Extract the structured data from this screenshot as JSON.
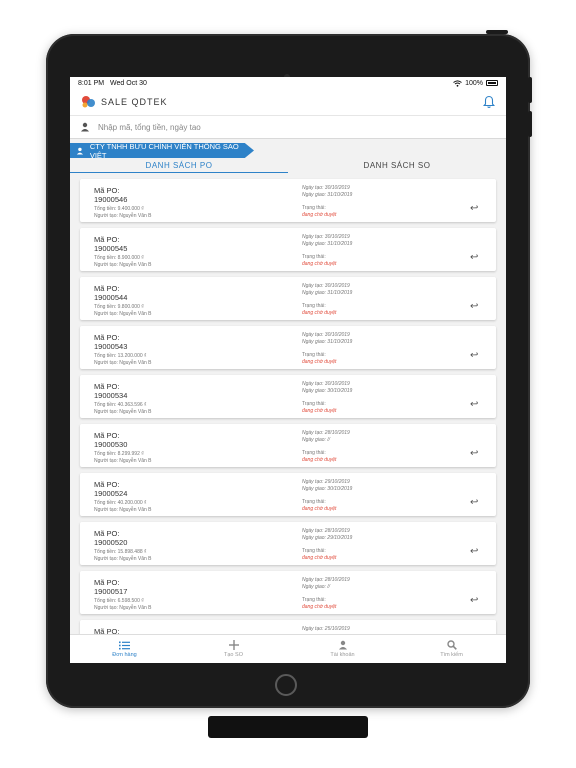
{
  "status_bar": {
    "time": "8:01 PM",
    "date": "Wed Oct 30",
    "battery": "100%"
  },
  "app_bar": {
    "title": "SALE QDTEK",
    "logo_icon": "qdtek-logo-icon",
    "bell_icon": "bell-icon"
  },
  "search": {
    "placeholder": "Nhập mã, tổng tiền, ngày tao",
    "icon": "user-icon"
  },
  "company": {
    "name": "CTY TNHH BƯU CHÍNH VIỄN THÔNG SAO VIỆT"
  },
  "tabs": [
    {
      "label": "DANH SÁCH PO",
      "active": true
    },
    {
      "label": "DANH SÁCH SO",
      "active": false
    }
  ],
  "orders": [
    {
      "po_label": "Mã PO:",
      "po_code": "19000546",
      "total": "Tổng tiền: 9.400.000 ₫",
      "creator": "Người tạo: Nguyễn Văn B",
      "created": "Ngày tạo: 30/10/2019",
      "delivery": "Ngày giao: 31/10/2019",
      "status_label": "Trạng thái:",
      "status": "đang chờ duyệt"
    },
    {
      "po_label": "Mã PO:",
      "po_code": "19000545",
      "total": "Tổng tiền: 8.900.000 ₫",
      "creator": "Người tạo: Nguyễn Văn B",
      "created": "Ngày tạo: 30/10/2019",
      "delivery": "Ngày giao: 31/10/2019",
      "status_label": "Trạng thái:",
      "status": "đang chờ duyệt"
    },
    {
      "po_label": "Mã PO:",
      "po_code": "19000544",
      "total": "Tổng tiền: 9.800.000 ₫",
      "creator": "Người tạo: Nguyễn Văn B",
      "created": "Ngày tạo: 30/10/2019",
      "delivery": "Ngày giao: 31/10/2019",
      "status_label": "Trạng thái:",
      "status": "đang chờ duyệt"
    },
    {
      "po_label": "Mã PO:",
      "po_code": "19000543",
      "total": "Tổng tiền: 13.200.000 ₫",
      "creator": "Người tạo: Nguyễn Văn B",
      "created": "Ngày tạo: 30/10/2019",
      "delivery": "Ngày giao: 31/10/2019",
      "status_label": "Trạng thái:",
      "status": "đang chờ duyệt"
    },
    {
      "po_label": "Mã PO:",
      "po_code": "19000534",
      "total": "Tổng tiền: 40.363.596 ₫",
      "creator": "Người tạo: Nguyễn Văn B",
      "created": "Ngày tạo: 30/10/2019",
      "delivery": "Ngày giao: 30/10/2019",
      "status_label": "Trạng thái:",
      "status": "đang chờ duyệt"
    },
    {
      "po_label": "Mã PO:",
      "po_code": "19000530",
      "total": "Tổng tiền: 8.299.992 ₫",
      "creator": "Người tạo: Nguyễn Văn B",
      "created": "Ngày tạo: 28/10/2019",
      "delivery": "Ngày giao: //",
      "status_label": "Trạng thái:",
      "status": "đang chờ duyệt"
    },
    {
      "po_label": "Mã PO:",
      "po_code": "19000524",
      "total": "Tổng tiền: 40.200.000 ₫",
      "creator": "Người tạo: Nguyễn Văn B",
      "created": "Ngày tạo: 29/10/2019",
      "delivery": "Ngày giao: 30/10/2019",
      "status_label": "Trạng thái:",
      "status": "đang chờ duyệt"
    },
    {
      "po_label": "Mã PO:",
      "po_code": "19000520",
      "total": "Tổng tiền: 15.898.488 ₫",
      "creator": "Người tạo: Nguyễn Văn B",
      "created": "Ngày tạo: 28/10/2019",
      "delivery": "Ngày giao: 29/10/2019",
      "status_label": "Trạng thái:",
      "status": "đang chờ duyệt"
    },
    {
      "po_label": "Mã PO:",
      "po_code": "19000517",
      "total": "Tổng tiền: 6.598.500 ₫",
      "creator": "Người tạo: Nguyễn Văn B",
      "created": "Ngày tạo: 28/10/2019",
      "delivery": "Ngày giao: //",
      "status_label": "Trạng thái:",
      "status": "đang chờ duyệt"
    }
  ],
  "partial_order": {
    "po_label": "Mã PO:",
    "created": "Ngày tạo: 25/10/2019"
  },
  "bottom_nav": [
    {
      "label": "Đơn hàng",
      "icon": "list-icon",
      "active": true
    },
    {
      "label": "Tạo SO",
      "icon": "plus-icon",
      "active": false
    },
    {
      "label": "Tài khoản",
      "icon": "person-icon",
      "active": false
    },
    {
      "label": "Tìm kiếm",
      "icon": "search-icon",
      "active": false
    }
  ],
  "colors": {
    "accent": "#2e82c8",
    "status": "#e14b3b",
    "device": "#1b1b1b"
  }
}
